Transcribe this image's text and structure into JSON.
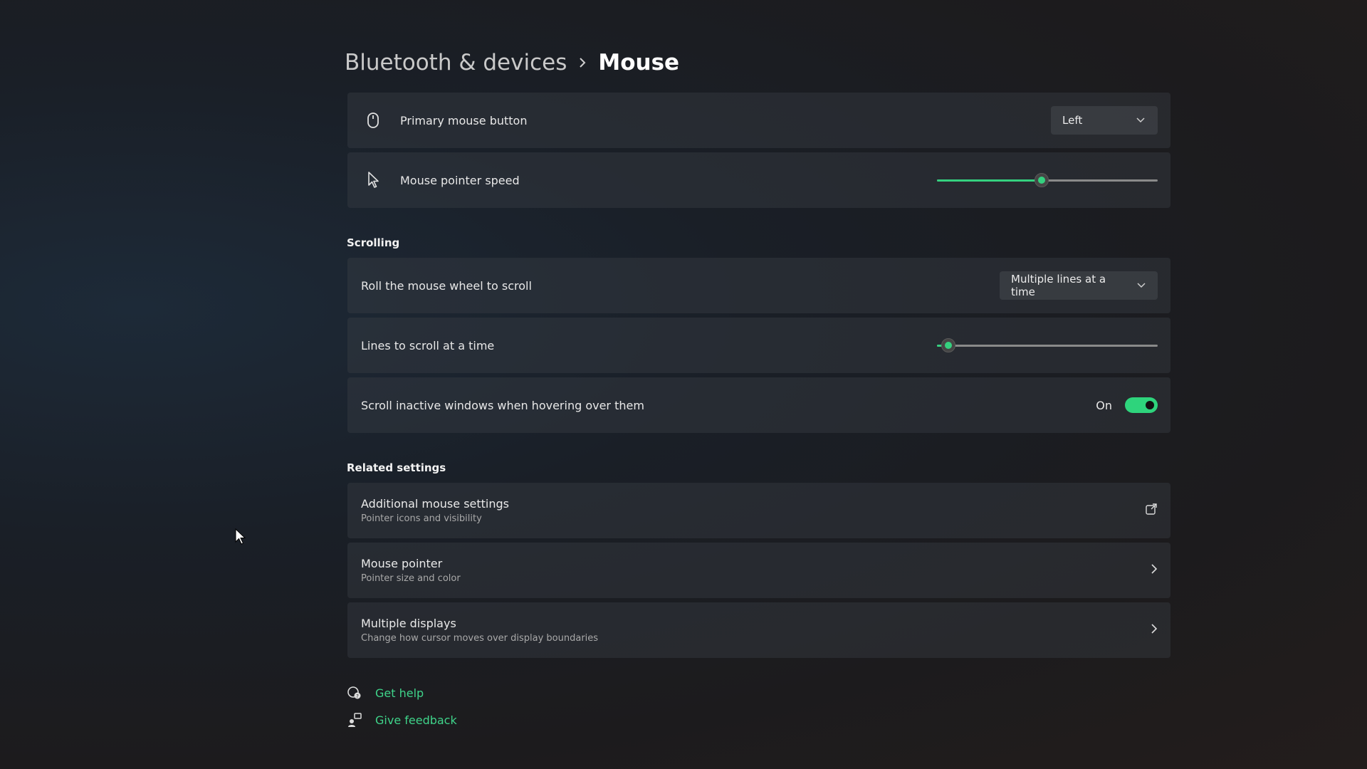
{
  "breadcrumb": {
    "parent": "Bluetooth & devices",
    "current": "Mouse"
  },
  "primary_button": {
    "label": "Primary mouse button",
    "value": "Left",
    "icon": "mouse-icon"
  },
  "pointer_speed": {
    "label": "Mouse pointer speed",
    "level": 0.475,
    "icon": "pointer-icon"
  },
  "scrolling": {
    "section_title": "Scrolling",
    "wheel_label": "Roll the mouse wheel to scroll",
    "wheel_value": "Multiple lines at a time",
    "lines_label": "Lines to scroll at a time",
    "lines_level": 0.05,
    "inactive_label": "Scroll inactive windows when hovering over them",
    "inactive_state": "On"
  },
  "related": {
    "section_title": "Related settings",
    "items": [
      {
        "title": "Additional mouse settings",
        "subtitle": "Pointer icons and visibility",
        "icon": "external-link-icon"
      },
      {
        "title": "Mouse pointer",
        "subtitle": "Pointer size and color",
        "icon": "chevron-right-icon"
      },
      {
        "title": "Multiple displays",
        "subtitle": "Change how cursor moves over display boundaries",
        "icon": "chevron-right-icon"
      }
    ]
  },
  "footer": {
    "help": "Get help",
    "feedback": "Give feedback"
  },
  "colors": {
    "accent": "#35d07f",
    "link": "#3fd48a",
    "card": "#3a3e46"
  }
}
